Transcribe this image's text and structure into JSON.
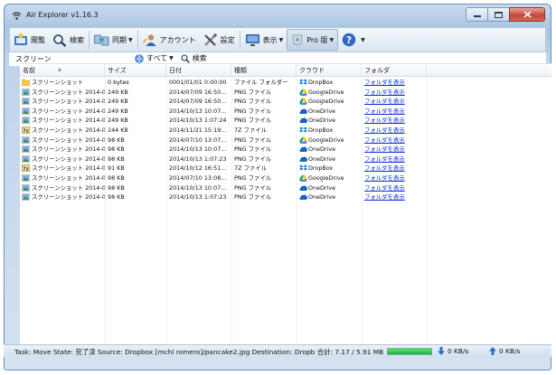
{
  "window": {
    "title": "Air Explorer v1.16.3"
  },
  "toolbar": {
    "open_label": "閲覧",
    "search_label": "検索",
    "sync_label": "同期",
    "account_label": "アカウント",
    "settings_label": "設定",
    "view_label": "表示",
    "pro_label": "Pro 版",
    "help_label": "?"
  },
  "pathbar": {
    "location": "スクリーン",
    "filter_label": "すべて",
    "search_label": "検索"
  },
  "columns": [
    "名前",
    "サイズ",
    "日付",
    "種類",
    "クラウド",
    "フォルダ"
  ],
  "rows": [
    {
      "icon": "folder-icon",
      "name": "スクリーンショット",
      "size": "0 bytes",
      "date": "0001/01/01 0:00:00",
      "type": "ファイル フォルダー",
      "cloud": "DropBox",
      "cloud_icon": "dropbox-icon",
      "folder": "フォルダを表示"
    },
    {
      "icon": "png-icon",
      "name": "スクリーンショット 2014-0...",
      "size": "249 KB",
      "date": "2014/07/09 16:50...",
      "type": "PNG ファイル",
      "cloud": "GoogleDrive",
      "cloud_icon": "googledrive-icon",
      "folder": "フォルダを表示"
    },
    {
      "icon": "png-icon",
      "name": "スクリーンショット 2014-0...",
      "size": "249 KB",
      "date": "2014/07/09 16:50...",
      "type": "PNG ファイル",
      "cloud": "GoogleDrive",
      "cloud_icon": "googledrive-icon",
      "folder": "フォルダを表示"
    },
    {
      "icon": "png-icon",
      "name": "スクリーンショット 2014-0...",
      "size": "249 KB",
      "date": "2014/10/13 10:07...",
      "type": "PNG ファイル",
      "cloud": "OneDrive",
      "cloud_icon": "onedrive-icon",
      "folder": "フォルダを表示"
    },
    {
      "icon": "png-icon",
      "name": "スクリーンショット 2014-0...",
      "size": "249 KB",
      "date": "2014/10/13 1:07:24",
      "type": "PNG ファイル",
      "cloud": "OneDrive",
      "cloud_icon": "onedrive-icon",
      "folder": "フォルダを表示"
    },
    {
      "icon": "zip-icon",
      "name": "スクリーンショット 2014-0...",
      "size": "244 KB",
      "date": "2014/11/21 15:19...",
      "type": "7Z ファイル",
      "cloud": "DropBox",
      "cloud_icon": "dropbox-icon",
      "folder": "フォルダを表示"
    },
    {
      "icon": "png-icon",
      "name": "スクリーンショット 2014-0...",
      "size": "98 KB",
      "date": "2014/07/10 13:07...",
      "type": "PNG ファイル",
      "cloud": "GoogleDrive",
      "cloud_icon": "googledrive-icon",
      "folder": "フォルダを表示"
    },
    {
      "icon": "png-icon",
      "name": "スクリーンショット 2014-0...",
      "size": "98 KB",
      "date": "2014/10/13 10:07...",
      "type": "PNG ファイル",
      "cloud": "OneDrive",
      "cloud_icon": "onedrive-icon",
      "folder": "フォルダを表示"
    },
    {
      "icon": "png-icon",
      "name": "スクリーンショット 2014-0...",
      "size": "98 KB",
      "date": "2014/10/13 1:07:23",
      "type": "PNG ファイル",
      "cloud": "OneDrive",
      "cloud_icon": "onedrive-icon",
      "folder": "フォルダを表示"
    },
    {
      "icon": "zip-icon",
      "name": "スクリーンショット 2014-0...",
      "size": "91 KB",
      "date": "2014/10/12 16:51...",
      "type": "7Z ファイル",
      "cloud": "DropBox",
      "cloud_icon": "dropbox-icon",
      "folder": "フォルダを表示"
    },
    {
      "icon": "png-icon",
      "name": "スクリーンショット 2014-0...",
      "size": "98 KB",
      "date": "2014/07/10 13:08...",
      "type": "PNG ファイル",
      "cloud": "GoogleDrive",
      "cloud_icon": "googledrive-icon",
      "folder": "フォルダを表示"
    },
    {
      "icon": "png-icon",
      "name": "スクリーンショット 2014-0...",
      "size": "98 KB",
      "date": "2014/10/13 10:07...",
      "type": "PNG ファイル",
      "cloud": "OneDrive",
      "cloud_icon": "onedrive-icon",
      "folder": "フォルダを表示"
    },
    {
      "icon": "png-icon",
      "name": "スクリーンショット 2014-0...",
      "size": "98 KB",
      "date": "2014/10/13 1:07:23",
      "type": "PNG ファイル",
      "cloud": "OneDrive",
      "cloud_icon": "onedrive-icon",
      "folder": "フォルダを表示"
    }
  ],
  "status": {
    "text": "Task: Move State: 完了済 Source: Dropbox [mchl romero]/pancake2.jpg Destination: Dropb 合計: 7.17 / 5.91 MB",
    "progress_percent": 100,
    "download_speed": "0 KB/s",
    "upload_speed": "0 KB/s"
  },
  "colors": {
    "link": "#0b2fd6",
    "progress": "#17b52f",
    "dropbox": "#1d7fe0",
    "onedrive": "#1565c0"
  }
}
